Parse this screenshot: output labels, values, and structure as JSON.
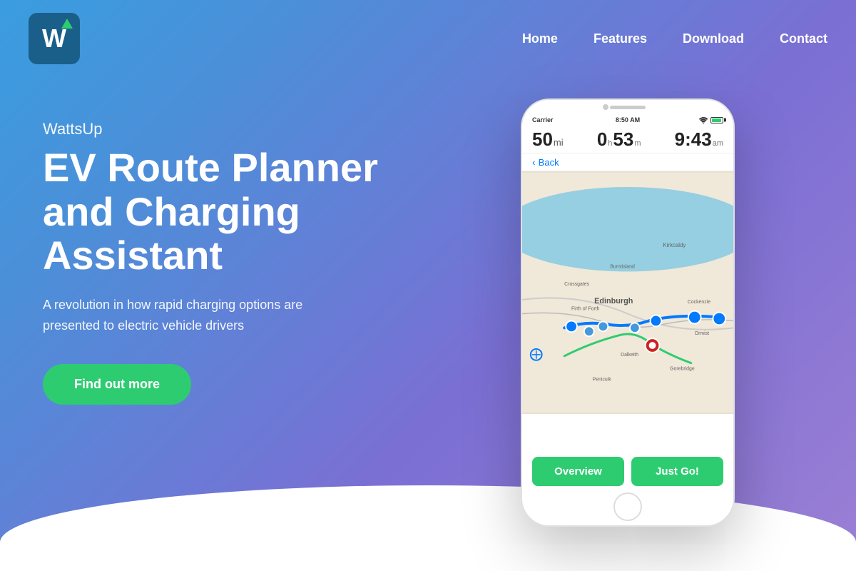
{
  "header": {
    "logo_letter": "W",
    "nav_items": [
      {
        "label": "Home",
        "id": "home"
      },
      {
        "label": "Features",
        "id": "features"
      },
      {
        "label": "Download",
        "id": "download"
      },
      {
        "label": "Contact",
        "id": "contact"
      }
    ]
  },
  "hero": {
    "brand": "WattsUp",
    "title": "EV Route Planner and Charging Assistant",
    "subtitle": "A revolution in how rapid charging options are presented to electric vehicle drivers",
    "cta_label": "Find out more"
  },
  "phone": {
    "status": {
      "carrier": "Carrier",
      "time": "8:50 AM"
    },
    "route": {
      "distance_num": "50",
      "distance_unit": "mi",
      "time_hours": "0",
      "time_hours_unit": "h",
      "time_mins": "53",
      "time_mins_unit": "m",
      "arrival": "9:43",
      "arrival_unit": "am"
    },
    "back_label": "Back",
    "btn_overview": "Overview",
    "btn_go": "Just Go!"
  }
}
